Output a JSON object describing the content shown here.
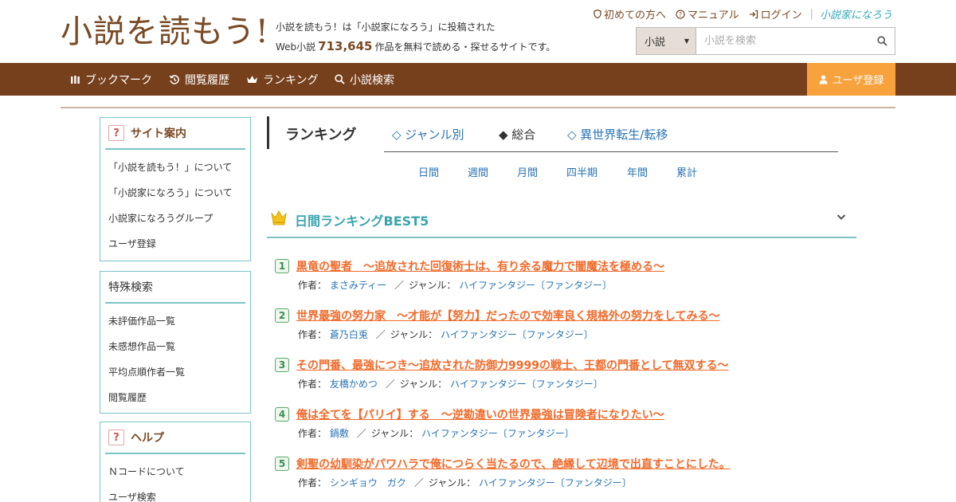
{
  "header": {
    "logo": "小説を読もう!",
    "tagline_line1": "小説を読もう！は「小説家になろう」に投稿された",
    "tagline_prefix": "Web小説",
    "work_count": "713,645",
    "tagline_suffix": "作品を無料で読める・探せるサイトです。",
    "links": [
      {
        "icon": "shield-icon",
        "label": "初めての方へ"
      },
      {
        "icon": "question-circle-icon",
        "label": "マニュアル"
      },
      {
        "icon": "login-icon",
        "label": "ログイン"
      }
    ],
    "partner_logo": "小説家になろう",
    "search": {
      "select_value": "小説",
      "placeholder": "小説を検索"
    }
  },
  "nav": {
    "items": [
      {
        "icon": "bookmark-icon",
        "label": "ブックマーク"
      },
      {
        "icon": "history-icon",
        "label": "閲覧履歴"
      },
      {
        "icon": "crown-icon",
        "label": "ランキング"
      },
      {
        "icon": "search-icon",
        "label": "小説検索"
      }
    ],
    "user_register": "ユーザ登録"
  },
  "sidebar": {
    "site_guide": {
      "title": "サイト案内",
      "items": [
        "「小説を読もう！」について",
        "「小説家になろう」について",
        "小説家になろうグループ",
        "ユーザ登録"
      ]
    },
    "special_search": {
      "title": "特殊検索",
      "items": [
        "未評価作品一覧",
        "未感想作品一覧",
        "平均点順作者一覧",
        "閲覧履歴"
      ]
    },
    "help": {
      "title": "ヘルプ",
      "items": [
        "Ｎコードについて",
        "ユーザ検索"
      ]
    }
  },
  "ranking": {
    "title": "ランキング",
    "tabs": [
      "◇ ジャンル別",
      "◆ 総合",
      "◇ 異世界転生/転移"
    ],
    "periods": [
      "日間",
      "週間",
      "月間",
      "四半期",
      "年間",
      "累計"
    ],
    "best5_title": "日間ランキングBEST5",
    "author_label": "作者：",
    "genre_label": "ジャンル：",
    "slash": "／",
    "items": [
      {
        "rank": "1",
        "title": "黒竜の聖者　〜追放された回復術士は、有り余る魔力で闇魔法を極める〜",
        "author": "まさみティー",
        "genre": "ハイファンタジー〔ファンタジー〕"
      },
      {
        "rank": "2",
        "title": "世界最強の努力家　〜才能が【努力】だったので効率良く規格外の努力をしてみる〜",
        "author": "蒼乃白兎",
        "genre": "ハイファンタジー〔ファンタジー〕"
      },
      {
        "rank": "3",
        "title": "その門番、最強につき～追放された防御力9999の戦士、王都の門番として無双する～",
        "author": "友橋かめつ",
        "genre": "ハイファンタジー〔ファンタジー〕"
      },
      {
        "rank": "4",
        "title": "俺は全てを【パリイ】する　〜逆勘違いの世界最強は冒険者になりたい〜",
        "author": "鍋敷",
        "genre": "ハイファンタジー〔ファンタジー〕"
      },
      {
        "rank": "5",
        "title": "剣聖の幼馴染がパワハラで俺につらく当たるので、絶縁して辺境で出直すことにした。",
        "author": "シンギョウ　ガク",
        "genre": "ハイファンタジー〔ファンタジー〕"
      }
    ]
  },
  "colors": {
    "brand": "#77401c",
    "accent": "#f7a23c",
    "teal": "#7cc3c9",
    "link": "#2a74b5",
    "title": "#f06a2a"
  }
}
